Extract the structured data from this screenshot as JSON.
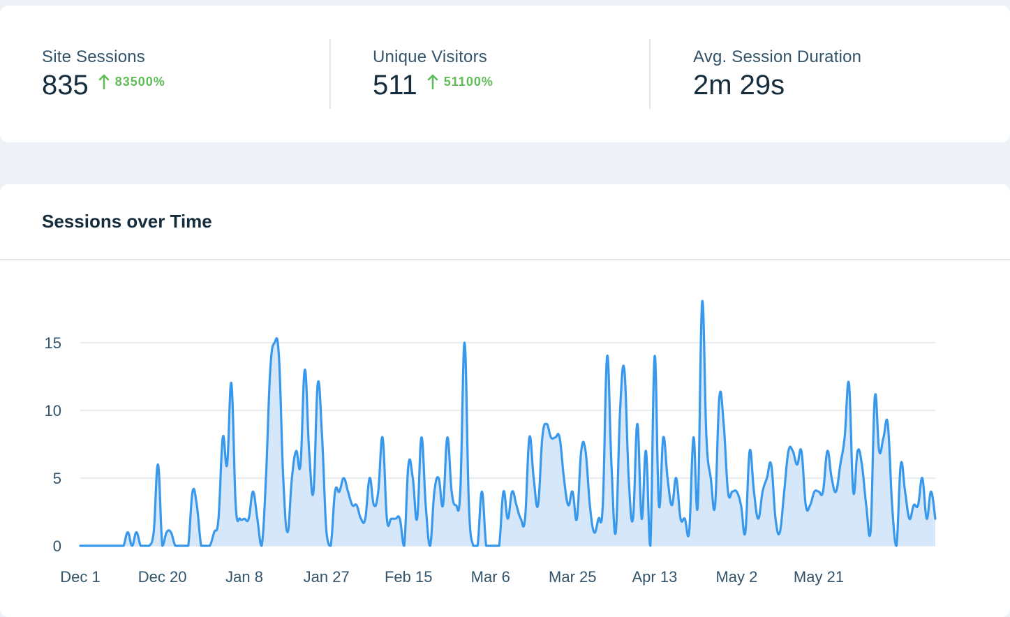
{
  "stats": [
    {
      "label": "Site Sessions",
      "value": "835",
      "change": "83500%"
    },
    {
      "label": "Unique Visitors",
      "value": "511",
      "change": "51100%"
    },
    {
      "label": "Avg. Session Duration",
      "value": "2m 29s"
    }
  ],
  "colors": {
    "line": "#3899ec",
    "area": "#d6e7fa",
    "grid": "#dfe5eb",
    "positive": "#60bc57"
  },
  "chart_data": {
    "type": "area",
    "title": "Sessions over Time",
    "xlabel": "",
    "ylabel": "",
    "ylim": [
      0,
      18
    ],
    "y_ticks": [
      0,
      5,
      10,
      15
    ],
    "grid": true,
    "x_tick_labels": [
      "Dec 1",
      "Dec 20",
      "Jan 8",
      "Jan 27",
      "Feb 15",
      "Mar 6",
      "Mar 25",
      "Apr 13",
      "May 2",
      "May 21"
    ],
    "series": [
      {
        "values": [
          0,
          0,
          0,
          0,
          0,
          0,
          0,
          0,
          0,
          0,
          0,
          1,
          0,
          1,
          0,
          0,
          0,
          1,
          6,
          0,
          1,
          1,
          0,
          0,
          0,
          0,
          4,
          3,
          0,
          0,
          0,
          1,
          2,
          8,
          6,
          12,
          3,
          2,
          2,
          2,
          4,
          2,
          0,
          5,
          13,
          15,
          14,
          5,
          1,
          5,
          7,
          6,
          13,
          7,
          4,
          12,
          8,
          1,
          0,
          4,
          4,
          5,
          4,
          3,
          3,
          2,
          2,
          5,
          3,
          4,
          8,
          2,
          2,
          2,
          2,
          0,
          6,
          5,
          2,
          8,
          3,
          0,
          4,
          5,
          3,
          8,
          4,
          3,
          4,
          15,
          3,
          0,
          0,
          4,
          0,
          0,
          0,
          0,
          4,
          2,
          4,
          3,
          2,
          2,
          8,
          5,
          3,
          8,
          9,
          8,
          8,
          8,
          5,
          3,
          4,
          2,
          7,
          7,
          3,
          1,
          2,
          3,
          14,
          6,
          1,
          10,
          13,
          5,
          2,
          9,
          2,
          7,
          0,
          14,
          3,
          8,
          5,
          3,
          5,
          2,
          2,
          1,
          8,
          3,
          18,
          8,
          5,
          3,
          11,
          9,
          4,
          4,
          4,
          3,
          1,
          7,
          4,
          2,
          4,
          5,
          6,
          2,
          1,
          4,
          7,
          7,
          6,
          7,
          3,
          3,
          4,
          4,
          4,
          7,
          5,
          4,
          6,
          8,
          12,
          4,
          7,
          6,
          3,
          1,
          11,
          7,
          8,
          9,
          3,
          0,
          6,
          4,
          2,
          3,
          3,
          5,
          2,
          4,
          2
        ]
      }
    ]
  }
}
